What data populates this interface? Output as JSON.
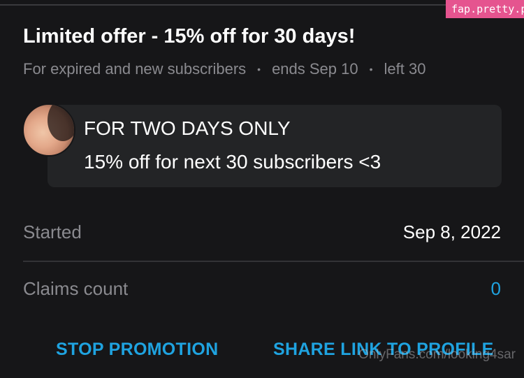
{
  "watermark_top": "fap.pretty.porn",
  "promo": {
    "title": "Limited offer - 15% off for 30 days!",
    "audience": "For expired and new subscribers",
    "ends": "ends Sep 10",
    "left": "left 30",
    "separator": "•"
  },
  "message": {
    "line1": "FOR TWO DAYS ONLY",
    "line2": "15% off for next 30 subscribers <3"
  },
  "details": {
    "started_label": "Started",
    "started_value": "Sep 8, 2022",
    "claims_label": "Claims count",
    "claims_value": "0"
  },
  "actions": {
    "stop_label": "STOP PROMOTION",
    "share_label": "SHARE LINK TO PROFILE"
  },
  "watermark_bottom": "OnlyFans.com/looking4sar",
  "colors": {
    "background": "#161618",
    "card": "#232426",
    "accent": "#1fa3e0",
    "muted_text": "#8a8a8f",
    "watermark_bg": "#e5548f"
  }
}
